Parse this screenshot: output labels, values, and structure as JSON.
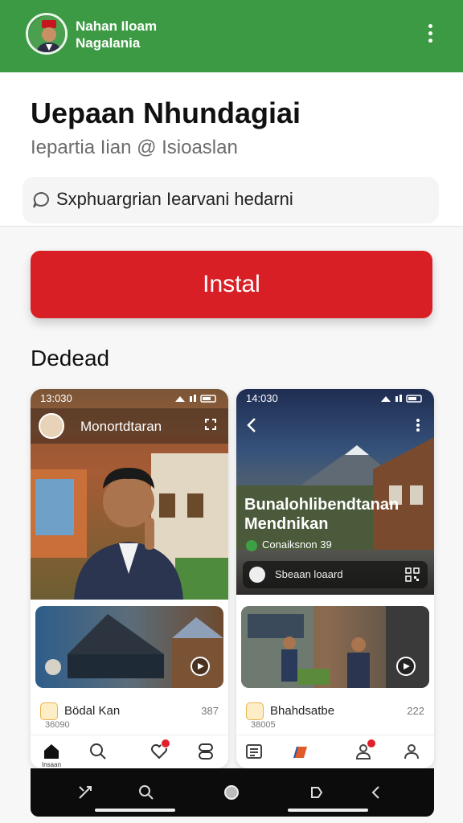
{
  "app_bar": {
    "title_line1": "Nahan Iloam",
    "title_line2": "Nagalania",
    "avatar_icon": "user-avatar-icon",
    "menu_icon": "more-vertical-icon",
    "bg_color": "#3c9a44"
  },
  "header": {
    "title": "Uepaan Nhundagiai",
    "subtitle": "Iepartia Iian @ Isioaslan",
    "info_chip": "Sxphuargrian Iearvani hedarni",
    "info_icon": "chat-bubble-icon"
  },
  "install_button": {
    "label": "Instal",
    "color": "#d81f26"
  },
  "section": {
    "label": "Dedead"
  },
  "cards": [
    {
      "status_time": "13:030",
      "profile_name": "Monortdtaran",
      "meta_name": "Bödal Kan",
      "meta_sub": "36090",
      "meta_count": "387"
    },
    {
      "status_time": "14:030",
      "overlay_title_line1": "Bunalohlibendtanan",
      "overlay_title_line2": "Mendnikan",
      "overlay_chip": "Conaiksnon 39",
      "search_text": "Sbeaan loaard",
      "meta_name": "Bhahdsatbe",
      "meta_sub": "38005",
      "meta_count": "222"
    }
  ],
  "card1_nav": {
    "home_label": "Insaan"
  }
}
